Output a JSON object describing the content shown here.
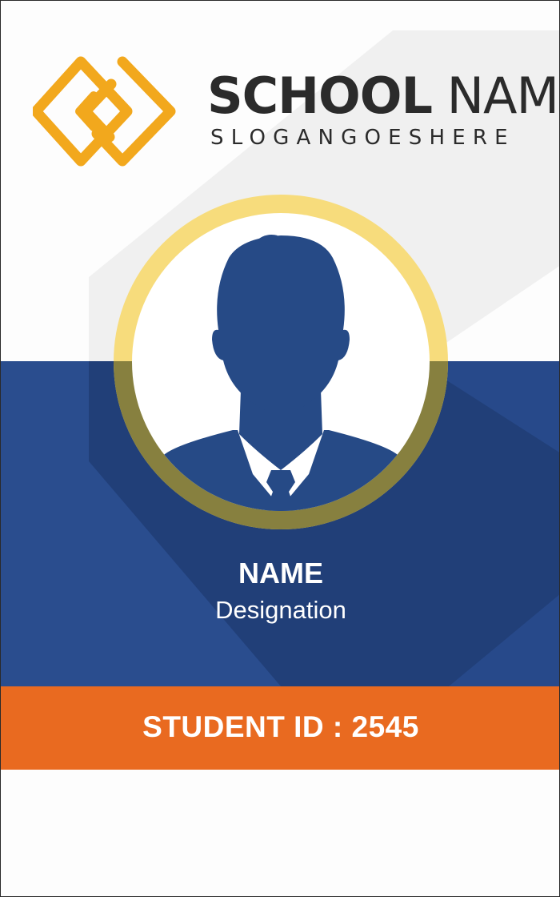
{
  "header": {
    "school_name_bold": "SCHOOL",
    "school_name_light": " NAME",
    "slogan": "SLOGANGOESHERE"
  },
  "logo": {
    "icon": "diamond-logo-icon",
    "color": "#f2a81d"
  },
  "photo": {
    "icon": "person-silhouette-icon",
    "ring_color": "#f7dc7c"
  },
  "person": {
    "name": "NAME",
    "designation": "Designation"
  },
  "footer": {
    "student_id": "STUDENT ID : 2545"
  },
  "colors": {
    "blue": "#27498a",
    "dark_blue": "#1f3c73",
    "orange": "#e96a20",
    "gold": "#f2a81d",
    "light_gray": "#efefef"
  }
}
